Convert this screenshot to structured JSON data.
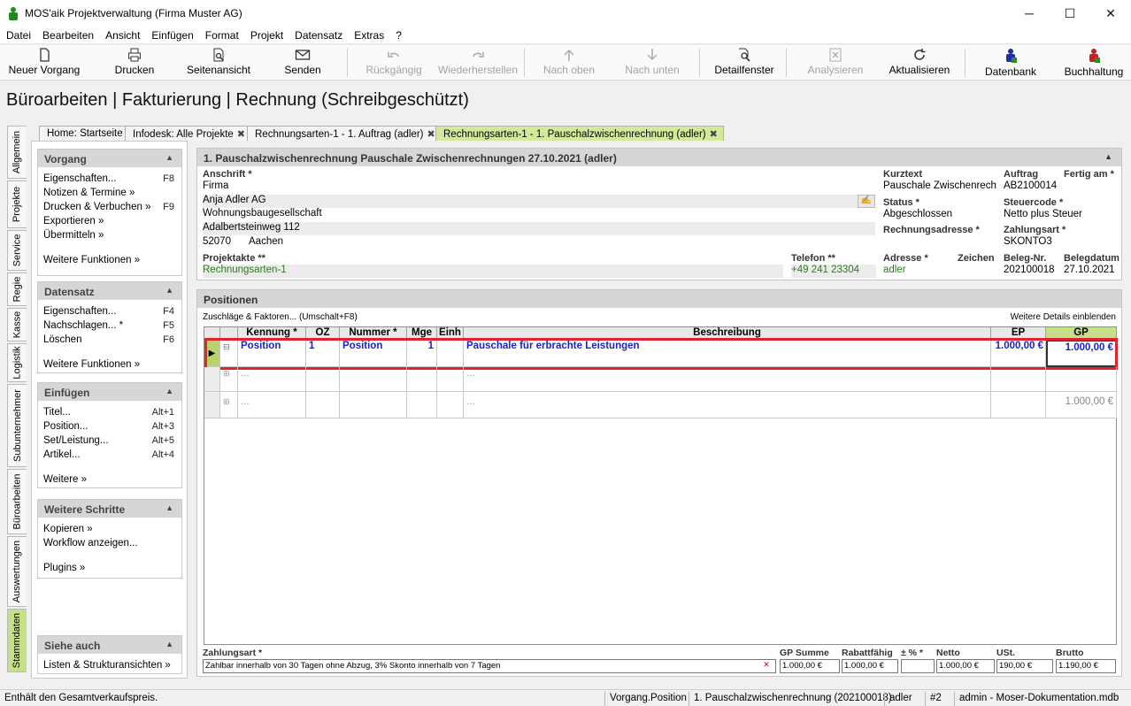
{
  "window": {
    "title": "MOS'aik Projektverwaltung (Firma Muster AG)",
    "min": "─",
    "max": "☐",
    "close": "✕"
  },
  "menu": [
    "Datei",
    "Bearbeiten",
    "Ansicht",
    "Einfügen",
    "Format",
    "Projekt",
    "Datensatz",
    "Extras",
    "?"
  ],
  "toolbar": {
    "neuer_vorgang": "Neuer Vorgang",
    "drucken": "Drucken",
    "seitenansicht": "Seitenansicht",
    "senden": "Senden",
    "rueckgaengig": "Rückgängig",
    "wiederherstellen": "Wiederherstellen",
    "nach_oben": "Nach oben",
    "nach_unten": "Nach unten",
    "detailfenster": "Detailfenster",
    "analysieren": "Analysieren",
    "aktualisieren": "Aktualisieren",
    "datenbank": "Datenbank",
    "buchhaltung": "Buchhaltung"
  },
  "page_title": "Büroarbeiten | Fakturierung | Rechnung (Schreibgeschützt)",
  "vtabs": [
    "Allgemein",
    "Projekte",
    "Service",
    "Regie",
    "Kasse",
    "Logistik",
    "Subunternehmer",
    "Büroarbeiten",
    "Auswertungen",
    "Stammdaten"
  ],
  "tabs": [
    {
      "label": "Home: Startseite"
    },
    {
      "label": "Infodesk: Alle Projekte",
      "close": "✖"
    },
    {
      "label": "Rechnungsarten-1 - 1. Auftrag (adler)",
      "close": "✖"
    },
    {
      "label": "Rechnungsarten-1 - 1. Pauschalzwischenrechnung (adler)",
      "close": "✖"
    }
  ],
  "left": {
    "vorgang": {
      "title": "Vorgang",
      "items": [
        {
          "label": "Eigenschaften...",
          "key": "F8"
        },
        {
          "label": "Notizen & Termine »",
          "key": ""
        },
        {
          "label": "Drucken & Verbuchen »",
          "key": "F9"
        },
        {
          "label": "Exportieren »",
          "key": ""
        },
        {
          "label": "Übermitteln »",
          "key": ""
        }
      ],
      "more": "Weitere Funktionen »"
    },
    "datensatz": {
      "title": "Datensatz",
      "items": [
        {
          "label": "Eigenschaften...",
          "key": "F4"
        },
        {
          "label": "Nachschlagen... *",
          "key": "F5"
        },
        {
          "label": "Löschen",
          "key": "F6"
        }
      ],
      "more": "Weitere Funktionen »"
    },
    "einfuegen": {
      "title": "Einfügen",
      "items": [
        {
          "label": "Titel...",
          "key": "Alt+1"
        },
        {
          "label": "Position...",
          "key": "Alt+3"
        },
        {
          "label": "Set/Leistung...",
          "key": "Alt+5"
        },
        {
          "label": "Artikel...",
          "key": "Alt+4"
        }
      ],
      "more": "Weitere »"
    },
    "schritte": {
      "title": "Weitere Schritte",
      "items": [
        {
          "label": "Kopieren »"
        },
        {
          "label": "Workflow anzeigen..."
        }
      ],
      "more": "Plugins »"
    },
    "siehe": {
      "title": "Siehe auch",
      "items": [
        {
          "label": "Listen & Strukturansichten »"
        }
      ]
    }
  },
  "header": {
    "title": "1. Pauschalzwischenrechnung Pauschale Zwischenrechnungen 27.10.2021 (adler)",
    "anschrift_label": "Anschrift *",
    "anschrift": [
      "Firma",
      "Anja Adler AG",
      "Wohnungsbaugesellschaft",
      "Adalbertsteinweg 112"
    ],
    "plz": "52070",
    "ort": "Aachen",
    "projektakte_label": "Projektakte **",
    "projektakte": "Rechnungsarten-1",
    "telefon_label": "Telefon **",
    "telefon": "+49 241 23304",
    "kurztext_label": "Kurztext",
    "kurztext": "Pauschale Zwischenrechnu",
    "auftrag_label": "Auftrag",
    "auftrag": "AB2100014",
    "fertig_label": "Fertig am *",
    "fertig": "",
    "status_label": "Status *",
    "status": "Abgeschlossen",
    "steuercode_label": "Steuercode *",
    "steuercode": "Netto plus Steuer",
    "rechnungsadresse_label": "Rechnungsadresse *",
    "rechnungsadresse": "",
    "zahlungsart_label": "Zahlungsart *",
    "zahlungsart": "SKONTO3",
    "adresse_label": "Adresse *",
    "adresse": "adler",
    "zeichen_label": "Zeichen",
    "zeichen": "",
    "belegnr_label": "Beleg-Nr.",
    "belegnr": "202100018",
    "belegdatum_label": "Belegdatum",
    "belegdatum": "27.10.2021"
  },
  "positions": {
    "title": "Positionen",
    "zuschlaege": "Zuschläge & Faktoren... (Umschalt+F8)",
    "details": "Weitere Details einblenden",
    "columns": {
      "kennung": "Kennung *",
      "oz": "OZ",
      "nummer": "Nummer *",
      "mge": "Mge",
      "einh": "Einh",
      "beschreibung": "Beschreibung",
      "ep": "EP",
      "gp": "GP"
    },
    "row": {
      "kennung": "Position",
      "oz": "1",
      "nummer": "Position",
      "mge": "1",
      "beschreibung": "Pauschale für erbrachte Leistungen",
      "ep": "1.000,00 €",
      "gp": "1.000,00 €"
    },
    "placeholder": "...",
    "total": "1.000,00 €"
  },
  "footer": {
    "zahlungsart_label": "Zahlungsart *",
    "zahlungsart": "Zahlbar innerhalb von 30 Tagen ohne Abzug, 3% Skonto innerhalb von 7 Tagen",
    "gpsumme_label": "GP Summe",
    "gpsumme": "1.000,00 €",
    "rabatt_label": "Rabattfähig",
    "rabatt": "1.000,00 €",
    "pct_label": "± % *",
    "pct": "",
    "netto_label": "Netto",
    "netto": "1.000,00 €",
    "ust_label": "USt.",
    "ust": "190,00 €",
    "brutto_label": "Brutto",
    "brutto": "1.190,00 €"
  },
  "status": {
    "hint": "Enthält den Gesamtverkaufspreis.",
    "ctx": "Vorgang.Position",
    "doc": "1. Pauschalzwischenrechnung (202100018)",
    "user": "adler",
    "num": "#2",
    "db": "admin - Moser-Dokumentation.mdb"
  },
  "colors": {
    "accent": "#c6e08a",
    "highlight": "#e0242f",
    "link_blue": "#1a24c8"
  }
}
